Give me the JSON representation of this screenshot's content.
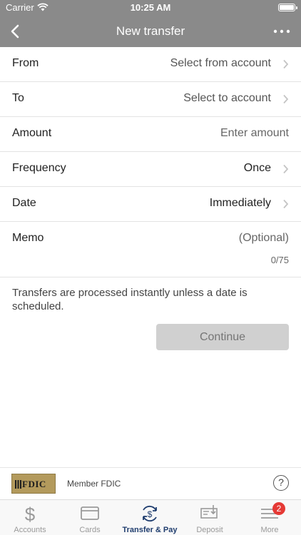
{
  "status_bar": {
    "carrier": "Carrier",
    "time": "10:25 AM"
  },
  "nav": {
    "title": "New transfer"
  },
  "form": {
    "from": {
      "label": "From",
      "value": "Select from account"
    },
    "to": {
      "label": "To",
      "value": "Select to account"
    },
    "amount": {
      "label": "Amount",
      "placeholder": "Enter amount"
    },
    "frequency": {
      "label": "Frequency",
      "value": "Once"
    },
    "date": {
      "label": "Date",
      "value": "Immediately"
    },
    "memo": {
      "label": "Memo",
      "placeholder": "(Optional)",
      "counter": "0/75"
    }
  },
  "info_text": "Transfers are processed instantly unless a date is scheduled.",
  "continue_label": "Continue",
  "fdic": {
    "logo_text": "FDIC",
    "member_text": "Member FDIC",
    "help_symbol": "?"
  },
  "tabs": [
    {
      "label": "Accounts",
      "icon": "dollar-icon"
    },
    {
      "label": "Cards",
      "icon": "card-icon"
    },
    {
      "label": "Transfer & Pay",
      "icon": "transfer-pay-icon",
      "active": true
    },
    {
      "label": "Deposit",
      "icon": "check-deposit-icon"
    },
    {
      "label": "More",
      "icon": "menu-icon",
      "badge": "2"
    }
  ],
  "colors": {
    "header": "#8a8a8a",
    "active_tab": "#1f3d6e",
    "badge": "#e53935",
    "button_disabled": "#d0d0d0"
  }
}
